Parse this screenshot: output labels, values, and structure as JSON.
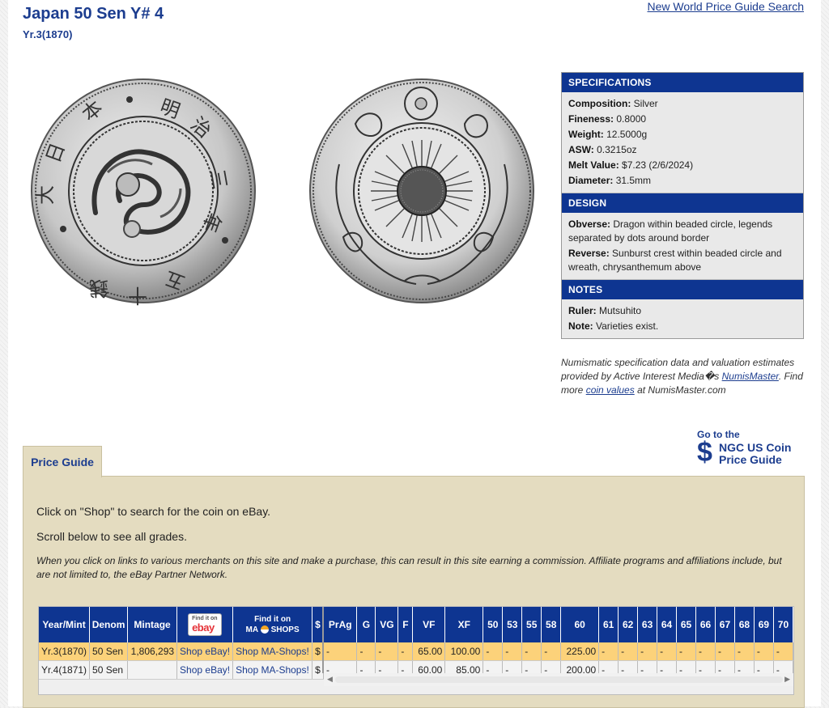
{
  "header": {
    "title": "Japan 50 Sen Y# 4",
    "subtitle": "Yr.3(1870)",
    "search_link": "New World Price Guide Search"
  },
  "specs": {
    "spec_heading": "SPECIFICATIONS",
    "composition_label": "Composition:",
    "composition": "Silver",
    "fineness_label": "Fineness:",
    "fineness": "0.8000",
    "weight_label": "Weight:",
    "weight": "12.5000g",
    "asw_label": "ASW:",
    "asw": "0.3215oz",
    "melt_label": "Melt Value:",
    "melt": "$7.23 (2/6/2024)",
    "diameter_label": "Diameter:",
    "diameter": "31.5mm",
    "design_heading": "DESIGN",
    "obverse_label": "Obverse:",
    "obverse": "Dragon within beaded circle, legends separated by dots around border",
    "reverse_label": "Reverse:",
    "reverse": "Sunburst crest within beaded circle and wreath, chrysanthemum above",
    "notes_heading": "NOTES",
    "ruler_label": "Ruler:",
    "ruler": "Mutsuhito",
    "note_label": "Note:",
    "note": "Varieties exist."
  },
  "attribution": {
    "line1": "Numismatic specification data and valuation estimates provided by Active Interest Media�s ",
    "numismaster_link": "NumisMaster",
    "line2": ". Find more ",
    "coin_values_link": "coin values",
    "line3": " at NumisMaster.com"
  },
  "ngc": {
    "go_to": "Go to the",
    "dollar": "$",
    "line1": "NGC US Coin",
    "line2": "Price Guide"
  },
  "price_guide": {
    "tab_label": "Price Guide",
    "info1": "Click on \"Shop\" to search for the coin on eBay.",
    "info2": "Scroll below to see all grades.",
    "disclaimer": "When you click on links to various merchants on this site and make a purchase, this can result in this site earning a commission. Affiliate programs and affiliations include, but are not limited to, the eBay Partner Network."
  },
  "table": {
    "headers": {
      "year": "Year/Mint",
      "denom": "Denom",
      "mintage": "Mintage",
      "ebay_find": "Find it on",
      "ebay_logo": "ebay",
      "ma_find": "Find it on",
      "ma_logo": "MA",
      "ma_shops": "SHOPS",
      "dollar": "$"
    },
    "grades": [
      "PrAg",
      "G",
      "VG",
      "F",
      "VF",
      "XF",
      "50",
      "53",
      "55",
      "58",
      "60",
      "61",
      "62",
      "63",
      "64",
      "65",
      "66",
      "67",
      "68",
      "69",
      "70"
    ],
    "rows": [
      {
        "year": "Yr.3(1870)",
        "denom": "50 Sen",
        "mintage": "1,806,293",
        "shop_ebay": "Shop eBay!",
        "shop_ma": "Shop MA-Shops!",
        "dollar": "$",
        "values": [
          "-",
          "-",
          "-",
          "-",
          "65.00",
          "100.00",
          "-",
          "-",
          "-",
          "-",
          "225.00",
          "-",
          "-",
          "-",
          "-",
          "-",
          "-",
          "-",
          "-",
          "-",
          "-"
        ]
      },
      {
        "year": "Yr.4(1871)",
        "denom": "50 Sen",
        "mintage": "",
        "shop_ebay": "Shop eBay!",
        "shop_ma": "Shop MA-Shops!",
        "dollar": "$",
        "values": [
          "-",
          "-",
          "-",
          "-",
          "60.00",
          "85.00",
          "-",
          "-",
          "-",
          "-",
          "200.00",
          "-",
          "-",
          "-",
          "-",
          "-",
          "-",
          "-",
          "-",
          "-",
          "-"
        ]
      }
    ]
  },
  "colors": {
    "brand_blue": "#1c3d8f",
    "header_blue": "#0e3591",
    "panel_tan": "#e4dcc0",
    "highlight_row": "#fcd27a"
  }
}
